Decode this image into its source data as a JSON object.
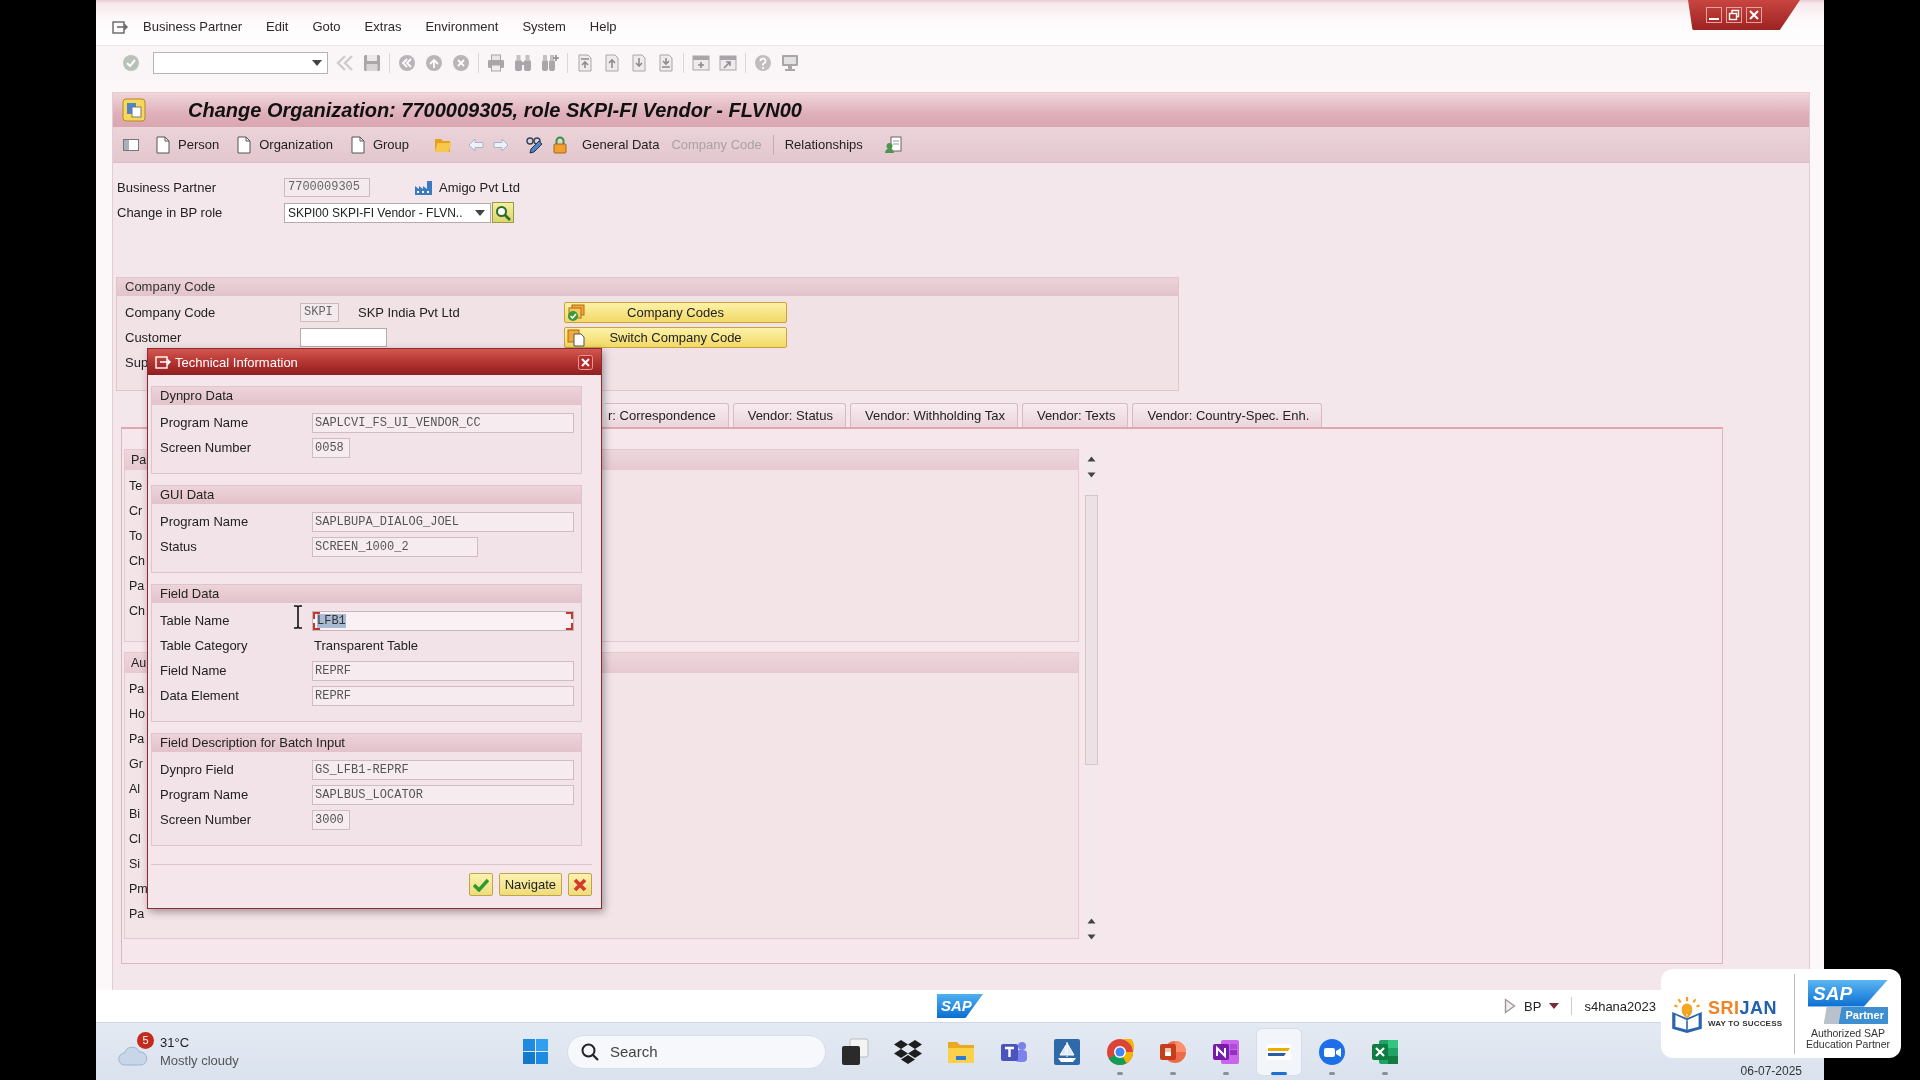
{
  "menu_bar": [
    "Business Partner",
    "Edit",
    "Goto",
    "Extras",
    "Environment",
    "System",
    "Help"
  ],
  "title": "Change Organization: 7700009305, role SKPI-FI Vendor - FLVN00",
  "create_buttons": [
    "Person",
    "Organization",
    "Group"
  ],
  "view_buttons": [
    {
      "label": "General Data",
      "disabled": false
    },
    {
      "label": "Company Code",
      "disabled": true
    },
    {
      "label": "Relationships",
      "disabled": false
    }
  ],
  "header_fields": [
    {
      "label": "Business Partner",
      "kind": "display",
      "value": "7700009305",
      "description": "Amigo Pvt Ltd"
    },
    {
      "label": "Change in BP role",
      "kind": "dropdown",
      "value": "SKPI00 SKPI-FI Vendor - FLVN.."
    }
  ],
  "company_code": {
    "title": "Company Code",
    "rows": [
      {
        "label": "Company Code",
        "kind": "display",
        "value": "SKPI",
        "description": "SKP India Pvt Ltd"
      },
      {
        "label": "Customer",
        "kind": "input"
      },
      {
        "label": "Sup",
        "kind": "covered"
      }
    ],
    "buttons": [
      "Company Codes",
      "Switch Company Code"
    ]
  },
  "tabs": [
    {
      "label": "r: Correspondence",
      "selected": false
    },
    {
      "label": "Vendor: Status",
      "selected": false
    },
    {
      "label": "Vendor: Withholding Tax",
      "selected": false
    },
    {
      "label": "Vendor: Texts",
      "selected": false
    },
    {
      "label": "Vendor: Country-Spec. Enh.",
      "selected": false
    }
  ],
  "tab_groups": [
    {
      "title": "Pa",
      "rows": [
        "Te",
        "Cr",
        "To",
        "Ch",
        "Pa",
        "Ch"
      ]
    },
    {
      "title": "Au",
      "rows": [
        "Pa",
        "Ho",
        "Pa",
        "Gr",
        "Al",
        "Bi",
        "Cl",
        "Si",
        "Pm",
        "Pa"
      ]
    }
  ],
  "dialog": {
    "title": "Technical Information",
    "sections": [
      {
        "title": "Dynpro Data",
        "rows": [
          {
            "label": "Program Name",
            "value": "SAPLCVI_FS_UI_VENDOR_CC",
            "kind": "long",
            "focused": false
          },
          {
            "label": "Screen Number",
            "value": "0058",
            "kind": "short",
            "focused": false
          }
        ]
      },
      {
        "title": "GUI Data",
        "rows": [
          {
            "label": "Program Name",
            "value": "SAPLBUPA_DIALOG_JOEL",
            "kind": "long",
            "focused": false
          },
          {
            "label": "Status",
            "value": "SCREEN_1000_2",
            "kind": "medium",
            "focused": false
          }
        ]
      },
      {
        "title": "Field Data",
        "rows": [
          {
            "label": "Table Name",
            "value": "LFB1",
            "kind": "long",
            "focused": true
          },
          {
            "label": "Table Category",
            "value": "Transparent Table",
            "kind": "text",
            "focused": false
          },
          {
            "label": "Field Name",
            "value": "REPRF",
            "kind": "long",
            "focused": false
          },
          {
            "label": "Data Element",
            "value": "REPRF",
            "kind": "long",
            "focused": false
          }
        ]
      },
      {
        "title": "Field Description for Batch Input",
        "rows": [
          {
            "label": "Dynpro Field",
            "value": "GS_LFB1-REPRF",
            "kind": "long",
            "focused": false
          },
          {
            "label": "Program Name",
            "value": "SAPLBUS_LOCATOR",
            "kind": "long",
            "focused": false
          },
          {
            "label": "Screen Number",
            "value": "3000",
            "kind": "short",
            "focused": false
          }
        ]
      }
    ],
    "navigate_button": "Navigate"
  },
  "status_bar": {
    "logo": "SAP",
    "transaction": "BP",
    "system": "s4hana2023"
  },
  "taskbar": {
    "weather": {
      "badge": "5",
      "temperature": "31°C",
      "condition": "Mostly cloudy"
    },
    "search": {
      "placeholder": "Search"
    },
    "apps": [
      {
        "running": false,
        "active": false
      },
      {
        "running": false,
        "active": false
      },
      {
        "running": false,
        "active": false
      },
      {
        "running": false,
        "active": false
      },
      {
        "running": false,
        "active": false
      },
      {
        "running": true,
        "active": false
      },
      {
        "running": true,
        "active": false
      },
      {
        "running": true,
        "active": false
      },
      {
        "running": true,
        "active": true
      },
      {
        "running": true,
        "active": false
      },
      {
        "running": true,
        "active": false
      }
    ],
    "date": "06-07-2025"
  },
  "partner_badge": {
    "brand": [
      {
        "text": "SRI",
        "color": "#ef8424"
      },
      {
        "text": "JAN",
        "color": "#2360ad"
      }
    ],
    "tagline": "WAY TO SUCCESS",
    "logo": "SAP",
    "logo_caption": "Partner",
    "caption": "Authorized SAP Education Partner"
  }
}
